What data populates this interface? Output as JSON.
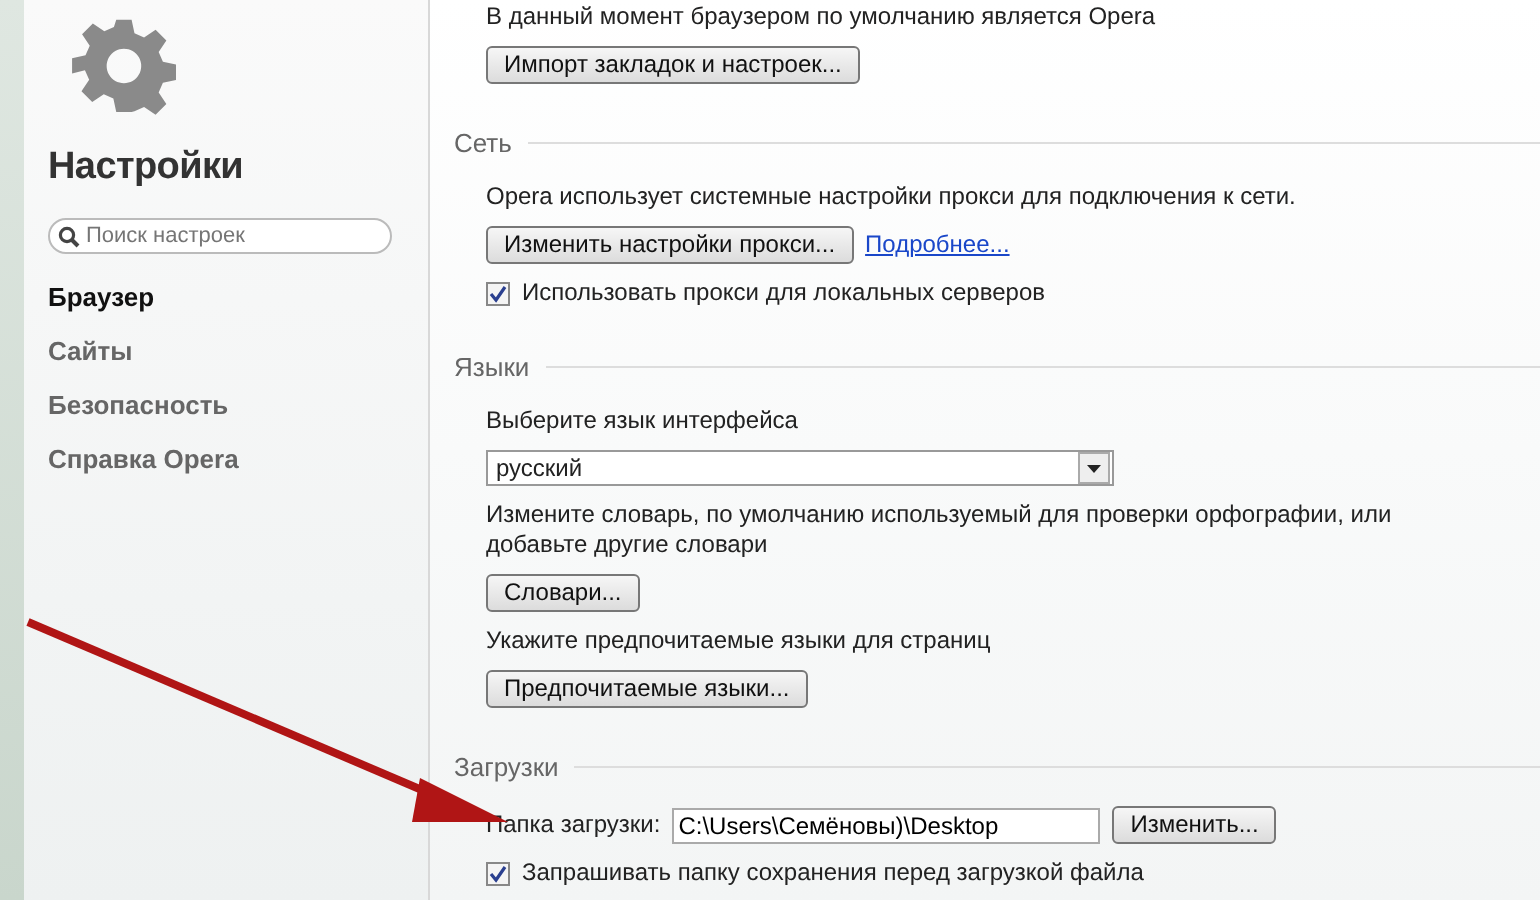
{
  "sidebar": {
    "title": "Настройки",
    "search": {
      "placeholder": "Поиск настроек"
    },
    "items": [
      {
        "label": "Браузер",
        "selected": true
      },
      {
        "label": "Сайты",
        "selected": false
      },
      {
        "label": "Безопасность",
        "selected": false
      },
      {
        "label": "Справка Opera",
        "selected": false
      }
    ]
  },
  "default_browser": {
    "text": "В данный момент браузером по умолчанию является Opera",
    "button": "Импорт закладок и настроек..."
  },
  "sections": [
    {
      "title": "Сеть",
      "rows": [
        {
          "kind": "text",
          "text": "Opera использует системные настройки прокси для подключения к сети."
        },
        {
          "kind": "button",
          "label": "Изменить настройки прокси...",
          "link": "Подробнее..."
        },
        {
          "kind": "checkbox",
          "label": "Использовать прокси для локальных серверов",
          "checked": true
        }
      ]
    },
    {
      "title": "Языки",
      "rows": [
        {
          "kind": "text",
          "text": "Выберите язык интерфейса"
        },
        {
          "kind": "select",
          "value": "русский"
        },
        {
          "kind": "text",
          "text": "Измените словарь, по умолчанию используемый для проверки орфографии, или добавьте другие словари"
        },
        {
          "kind": "button",
          "label": "Словари..."
        },
        {
          "kind": "text",
          "text": "Укажите предпочитаемые языки для страниц"
        },
        {
          "kind": "button",
          "label": "Предпочитаемые языки..."
        }
      ]
    },
    {
      "title": "Загрузки",
      "rows": [
        {
          "kind": "path",
          "label": "Папка загрузки:",
          "value": "C:\\Users\\Семёновы)\\Desktop",
          "button": "Изменить..."
        },
        {
          "kind": "checkbox",
          "label": "Запрашивать папку сохранения перед загрузкой файла",
          "checked": true
        }
      ]
    }
  ]
}
